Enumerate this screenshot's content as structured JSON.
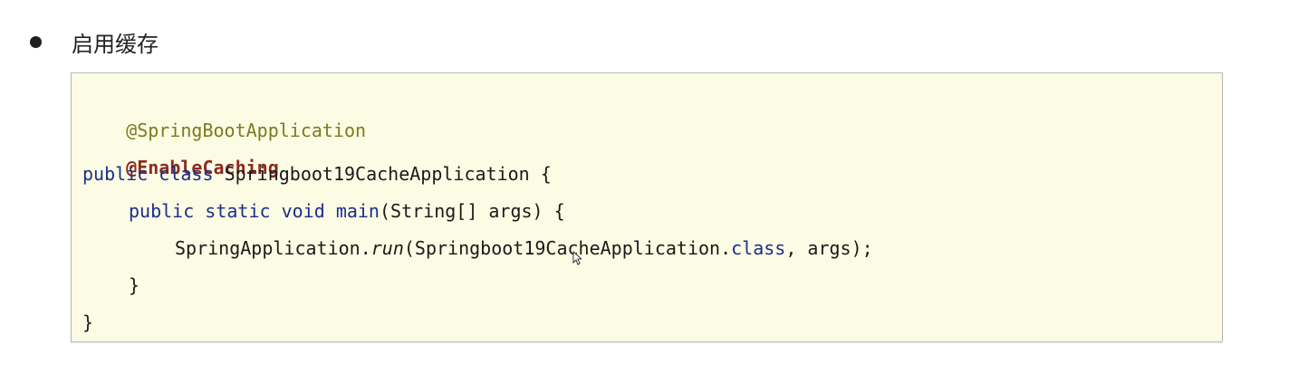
{
  "bullet": {
    "text": "启用缓存"
  },
  "code": {
    "line1": {
      "annotation": "@SpringBootApplication"
    },
    "line2": {
      "annotation": "@EnableCaching"
    },
    "line3": {
      "kw_public": "public",
      "kw_class": "class",
      "class_name": "Springboot19CacheApplication",
      "open_brace": "{"
    },
    "line4": {
      "kw_public": "public",
      "kw_static": "static",
      "kw_void": "void",
      "method": "main",
      "signature": "(String[] args) {"
    },
    "line5": {
      "receiver": "SpringApplication.",
      "call": "run",
      "open_paren": "(Springboot19CacheApplication.",
      "kw_class": "class",
      "rest": ", args);"
    },
    "line6": {
      "close_brace": "}"
    },
    "line7": {
      "close_brace": "}"
    }
  },
  "colors": {
    "background": "#ffffff",
    "code_background": "#fcfbe4",
    "annotation": "#7d7a1e",
    "annotation_bold": "#8b2b20",
    "keyword": "#1a2f8a"
  },
  "icons": {
    "bullet": "bullet-dot-icon",
    "cursor": "mouse-pointer-icon"
  }
}
